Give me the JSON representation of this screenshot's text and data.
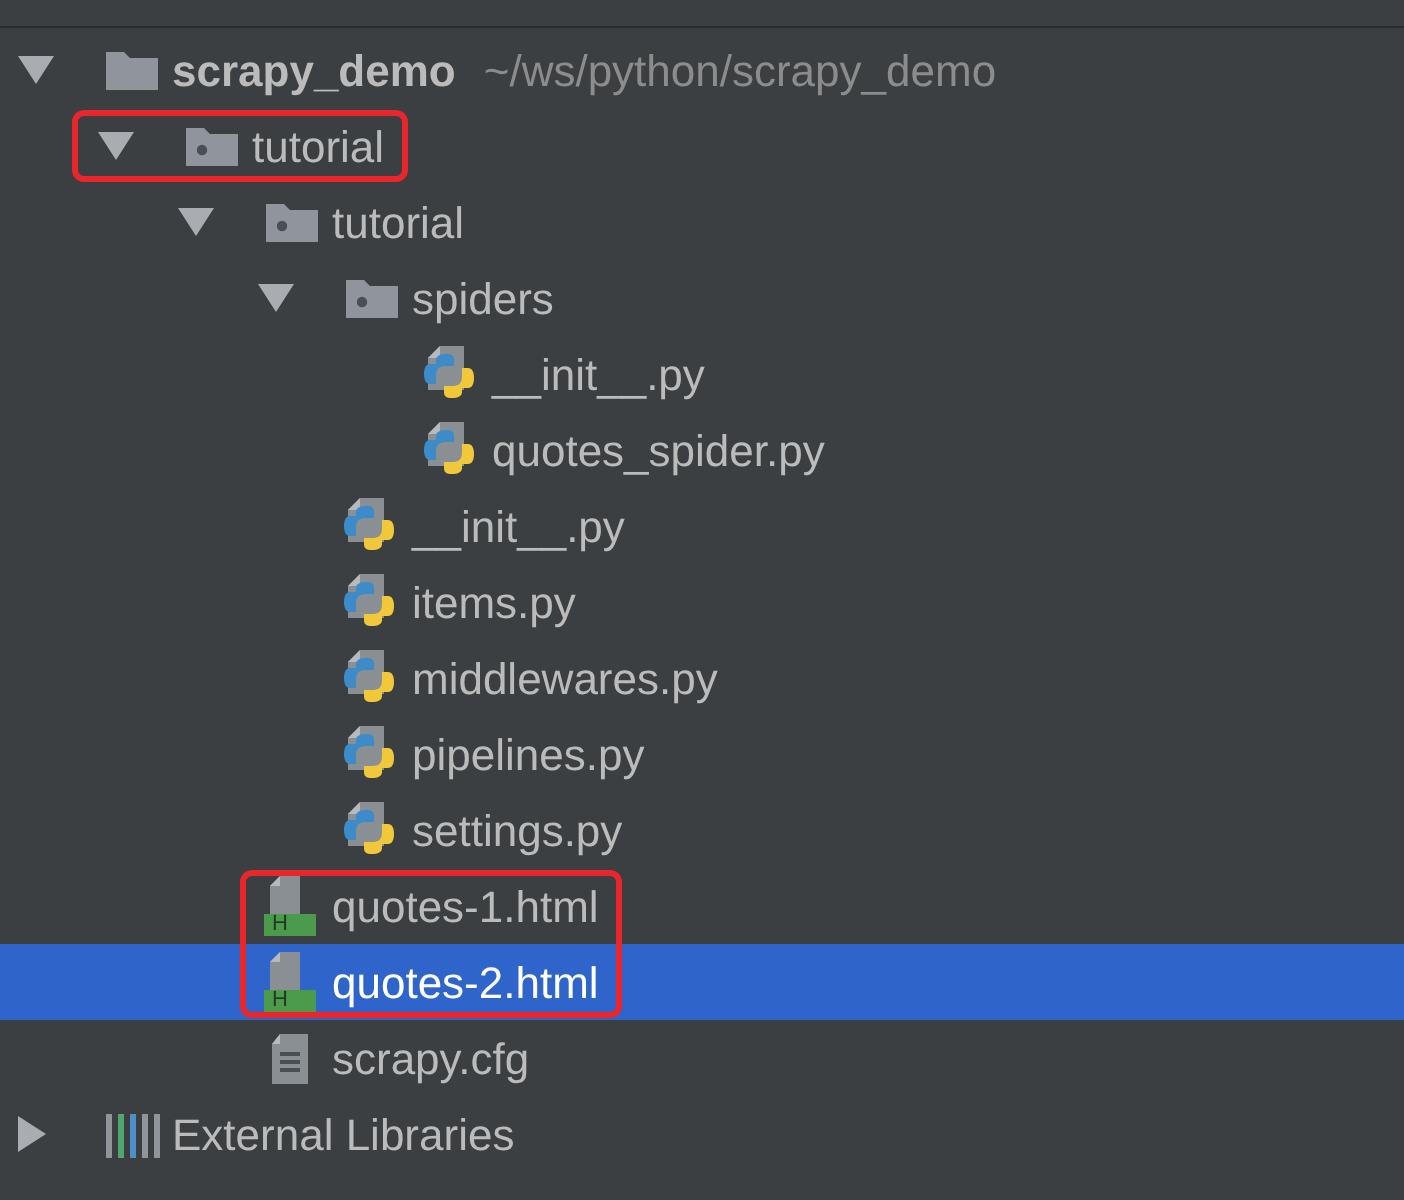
{
  "tree": [
    {
      "kind": "project",
      "label": "scrapy_demo",
      "path": "~/ws/python/scrapy_demo",
      "expanded": true,
      "selected": false,
      "highlighted": false,
      "children": [
        {
          "kind": "folder",
          "label": "tutorial",
          "expanded": true,
          "selected": false,
          "highlighted": true,
          "children": [
            {
              "kind": "folder",
              "label": "tutorial",
              "expanded": true,
              "selected": false,
              "highlighted": false,
              "children": [
                {
                  "kind": "folder",
                  "label": "spiders",
                  "expanded": true,
                  "selected": false,
                  "highlighted": false,
                  "children": [
                    {
                      "kind": "python",
                      "label": "__init__.py",
                      "selected": false,
                      "highlighted": false
                    },
                    {
                      "kind": "python",
                      "label": "quotes_spider.py",
                      "selected": false,
                      "highlighted": false
                    }
                  ]
                },
                {
                  "kind": "python",
                  "label": "__init__.py",
                  "selected": false,
                  "highlighted": false
                },
                {
                  "kind": "python",
                  "label": "items.py",
                  "selected": false,
                  "highlighted": false
                },
                {
                  "kind": "python",
                  "label": "middlewares.py",
                  "selected": false,
                  "highlighted": false
                },
                {
                  "kind": "python",
                  "label": "pipelines.py",
                  "selected": false,
                  "highlighted": false
                },
                {
                  "kind": "python",
                  "label": "settings.py",
                  "selected": false,
                  "highlighted": false
                }
              ]
            },
            {
              "kind": "html",
              "label": "quotes-1.html",
              "badge": "H",
              "selected": false,
              "highlighted": true
            },
            {
              "kind": "html",
              "label": "quotes-2.html",
              "badge": "H",
              "selected": true,
              "highlighted": true
            },
            {
              "kind": "config",
              "label": "scrapy.cfg",
              "selected": false,
              "highlighted": false
            }
          ]
        }
      ]
    },
    {
      "kind": "libraries",
      "label": "External Libraries",
      "expanded": false,
      "selected": false,
      "highlighted": false
    }
  ]
}
